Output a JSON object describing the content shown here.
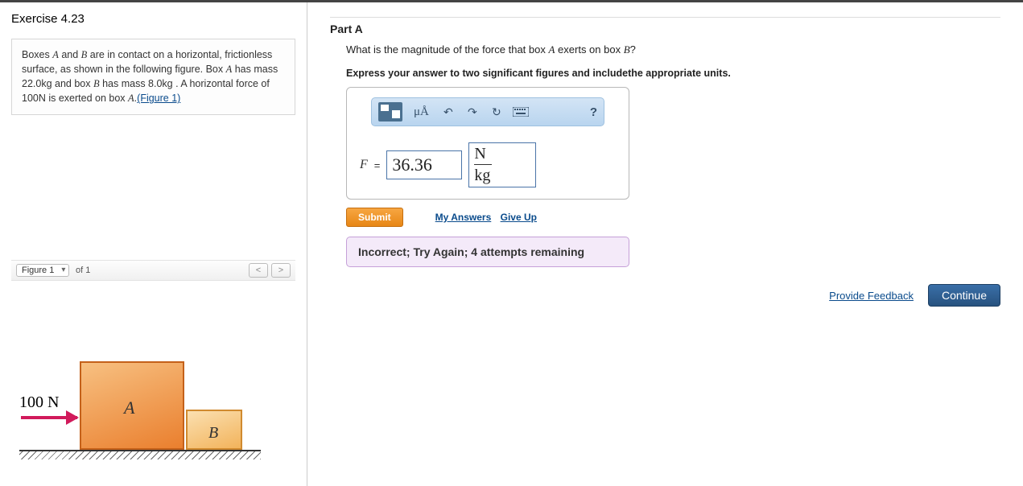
{
  "exercise_title": "Exercise 4.23",
  "problem": {
    "line1_pre": "Boxes ",
    "boxA": "A",
    "line1_mid": " and ",
    "boxB": "B",
    "line1_post": " are in contact on a horizontal, frictionless surface, as shown in the following figure. Box ",
    "line2_pre": "",
    "line2_A": "A",
    "line2_mid": " has mass 22.0kg and box ",
    "line2_B": "B",
    "line2_post": " has mass 8.0kg . A horizontal force of 100N is exerted on box ",
    "line3_A": "A",
    "line3_post": ".",
    "figure_link": "(Figure 1)"
  },
  "figure_bar": {
    "select_label": "Figure 1",
    "of_label": "of 1",
    "prev": "<",
    "next": ">"
  },
  "figure": {
    "force_label": "100 N",
    "boxA_label": "A",
    "boxB_label": "B"
  },
  "partA": {
    "header": "Part A",
    "question_pre": "What is the magnitude of the force that box ",
    "question_A": "A",
    "question_mid": " exerts on box ",
    "question_B": "B",
    "question_post": "?",
    "instruction": "Express your answer to two significant figures and includethe appropriate units."
  },
  "toolbar": {
    "mu_label": "μÅ",
    "help": "?"
  },
  "answer": {
    "var_label": "F",
    "equals": " = ",
    "value": "36.36",
    "unit_num": "N",
    "unit_den": "kg"
  },
  "actions": {
    "submit": "Submit",
    "my_answers": "My Answers",
    "give_up": "Give Up"
  },
  "feedback": "Incorrect; Try Again; 4 attempts remaining",
  "bottom": {
    "provide_feedback": "Provide Feedback",
    "continue": "Continue"
  }
}
